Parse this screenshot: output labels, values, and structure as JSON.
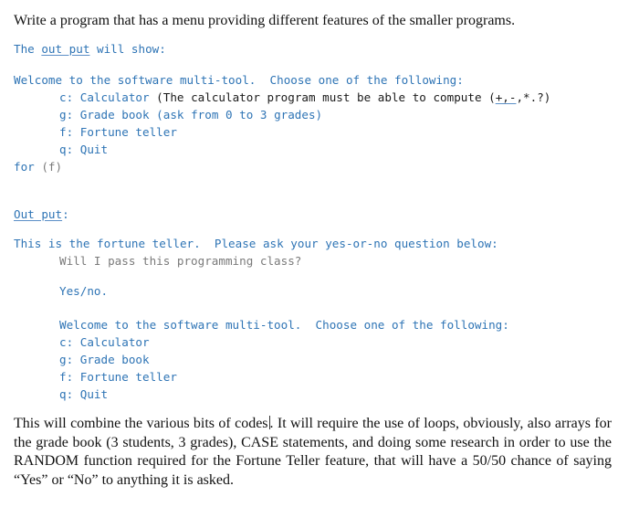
{
  "title": "Write a program that has a menu providing different features of the smaller programs.",
  "output_intro": {
    "prefix": "The ",
    "underlined": "out put",
    "suffix": " will show:"
  },
  "menu1": {
    "header": "Welcome to the software multi-tool.  Choose one of the following:",
    "items": [
      {
        "key": "c:",
        "label": "Calculator",
        "note_prefix": " (The calculator program must be able to compute (",
        "note_underlined": "+,-",
        "note_suffix": ",*.?)"
      },
      {
        "key": "g:",
        "label": "Grade book (ask from 0 to 3 grades)"
      },
      {
        "key": "f:",
        "label": "Fortune teller"
      },
      {
        "key": "q:",
        "label": "Quit"
      }
    ],
    "footer_prefix": "for ",
    "footer_arg": "(f)"
  },
  "output_label": {
    "underlined": "Out put",
    "suffix": ":"
  },
  "fortune": {
    "header": "This is the fortune teller.  Please ask your yes-or-no question below:",
    "question": "Will I pass this programming class?",
    "answer": "Yes/no."
  },
  "menu2": {
    "header": "Welcome to the software multi-tool.  Choose one of the following:",
    "items": [
      {
        "text": "c: Calculator"
      },
      {
        "text": "g: Grade book"
      },
      {
        "text": "f: Fortune teller"
      },
      {
        "text": "q: Quit"
      }
    ]
  },
  "paragraph": {
    "part1": "This will combine the various bits of codes",
    "part2": ".  It will require the use of loops, obviously, also arrays for the grade book (3 students, 3 grades), CASE statements, and doing some research in order to use the RANDOM function required for the Fortune Teller feature, that will have a 50/50 chance of saying “Yes” or “No” to anything it is asked."
  },
  "colors": {
    "code_blue": "#2e74b5",
    "code_black": "#1a1a1a",
    "code_gray": "#7a7a7a",
    "text": "#111111"
  }
}
